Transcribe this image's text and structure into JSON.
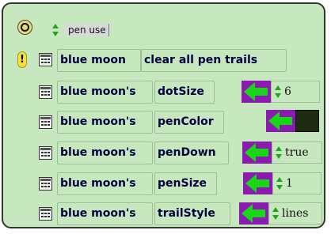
{
  "script": {
    "category_label": "pen use",
    "warning_glyph": "!",
    "rows": [
      {
        "sprite": "blue moon",
        "command": "clear all pen trails"
      },
      {
        "sprite": "blue moon's",
        "property": "dotSize",
        "value": "6"
      },
      {
        "sprite": "blue moon's",
        "property": "penColor",
        "value_color": "#1e2a12"
      },
      {
        "sprite": "blue moon's",
        "property": "penDown",
        "value": "true"
      },
      {
        "sprite": "blue moon's",
        "property": "penSize",
        "value": "1"
      },
      {
        "sprite": "blue moon's",
        "property": "trailStyle",
        "value": "lines"
      }
    ]
  },
  "colors": {
    "script_background": "#c7e8bf",
    "assign_arrow": "#19d619",
    "assign_box": "#8b1ab0",
    "warning": "#f7e23b"
  },
  "icons": {
    "menu": "script-menu-icon",
    "updown": "up-down-arrows-icon",
    "tile": "tile-handle-icon",
    "assign": "assign-arrow-icon",
    "warning": "warning-icon"
  }
}
